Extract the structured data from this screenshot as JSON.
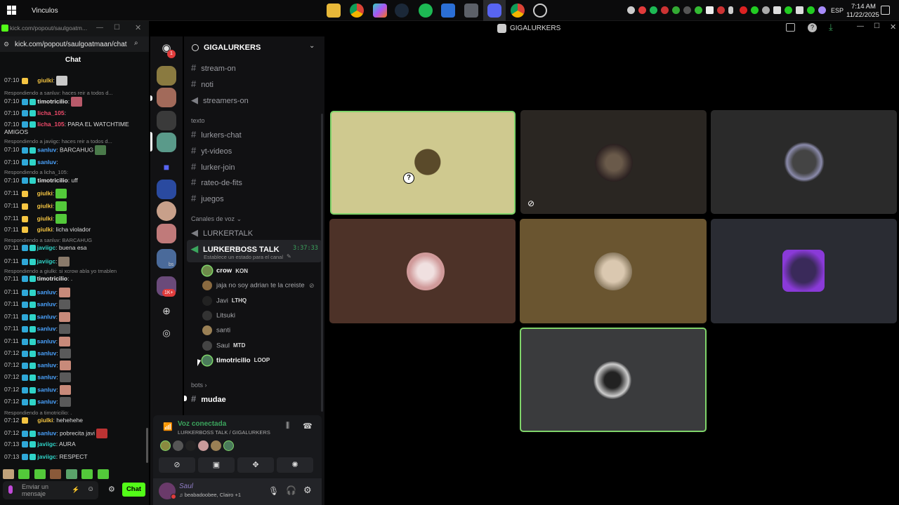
{
  "taskbar": {
    "app_name": "Vinculos",
    "language": "ESP",
    "time": "7:14 AM",
    "date": "11/22/2025"
  },
  "kick": {
    "window_title": "kick.com/popout/saulgoatm...",
    "url": "kick.com/popout/saulgoatmaan/chat",
    "chat_header": "Chat",
    "input_placeholder": "Enviar un mensaje",
    "chat_button": "Chat",
    "messages": [
      {
        "time": "07:10",
        "user": "giulki",
        "color": "#f5c542",
        "text": ":"
      },
      {
        "reply": "Respondiendo a sanluv: haces reir a todos d..."
      },
      {
        "time": "07:10",
        "user": "timotricilio",
        "color": "#e8e8e8",
        "text": ":"
      },
      {
        "time": "07:10",
        "user": "licha_105",
        "color": "#f04a6a",
        "text": ":"
      },
      {
        "time": "07:10",
        "user": "licha_105",
        "color": "#f04a6a",
        "text": ": PARA EL WATCHTIME",
        "cont": "AMIGOS"
      },
      {
        "reply": "Respondiendo a javiigc: haces reir a todos d..."
      },
      {
        "time": "07:10",
        "user": "sanluv",
        "color": "#4aa3ff",
        "text": ": BARCAHUG"
      },
      {
        "time": "07:10",
        "user": "sanluv",
        "color": "#4aa3ff",
        "text": ":"
      },
      {
        "reply": "Respondiendo a licha_105:"
      },
      {
        "time": "07:10",
        "user": "timotricilio",
        "color": "#e8e8e8",
        "text": ": uff"
      },
      {
        "time": "07:11",
        "user": "giulki",
        "color": "#f5c542",
        "text": ":"
      },
      {
        "time": "07:11",
        "user": "giulki",
        "color": "#f5c542",
        "text": ":"
      },
      {
        "time": "07:11",
        "user": "giulki",
        "color": "#f5c542",
        "text": ":"
      },
      {
        "time": "07:11",
        "user": "giulki",
        "color": "#f5c542",
        "text": ": licha violador"
      },
      {
        "reply": "Respondiendo a sanluv: BARCAHUG"
      },
      {
        "time": "07:11",
        "user": "javiigc",
        "color": "#2fd4c8",
        "text": ": buena esa"
      },
      {
        "time": "07:11",
        "user": "javiigc",
        "color": "#2fd4c8",
        "text": ":"
      },
      {
        "reply": "Respondiendo a giulki: si xcrow abla yo tmablen"
      },
      {
        "time": "07:11",
        "user": "timotricilio",
        "color": "#e8e8e8",
        "text": ": ."
      },
      {
        "time": "07:11",
        "user": "sanluv",
        "color": "#4aa3ff",
        "text": ":"
      },
      {
        "time": "07:11",
        "user": "sanluv",
        "color": "#4aa3ff",
        "text": ":"
      },
      {
        "time": "07:11",
        "user": "sanluv",
        "color": "#4aa3ff",
        "text": ":"
      },
      {
        "time": "07:11",
        "user": "sanluv",
        "color": "#4aa3ff",
        "text": ":"
      },
      {
        "time": "07:11",
        "user": "sanluv",
        "color": "#4aa3ff",
        "text": ":"
      },
      {
        "time": "07:12",
        "user": "sanluv",
        "color": "#4aa3ff",
        "text": ":"
      },
      {
        "time": "07:12",
        "user": "sanluv",
        "color": "#4aa3ff",
        "text": ":"
      },
      {
        "time": "07:12",
        "user": "sanluv",
        "color": "#4aa3ff",
        "text": ":"
      },
      {
        "time": "07:12",
        "user": "sanluv",
        "color": "#4aa3ff",
        "text": ":"
      },
      {
        "time": "07:12",
        "user": "sanluv",
        "color": "#4aa3ff",
        "text": ":"
      },
      {
        "reply": "Respondiendo a timotricilio: ."
      },
      {
        "time": "07:12",
        "user": "giulki",
        "color": "#f5c542",
        "text": ": hehehehe"
      },
      {
        "time": "07:12",
        "user": "sanluv",
        "color": "#4aa3ff",
        "text": ": pobrecita javi"
      },
      {
        "time": "07:13",
        "user": "javiigc",
        "color": "#2fd4c8",
        "text": ": AURA"
      },
      {
        "time": "07:13",
        "user": "javiigc",
        "color": "#2fd4c8",
        "text": ": RESPECT"
      }
    ]
  },
  "discord": {
    "window_title": "GIGALURKERS",
    "server_name": "GIGALURKERS",
    "server_badge": "1",
    "server_badge_2": "1K+",
    "server_small_label": "bs",
    "channels_top": [
      "stream-on",
      "noti",
      "streamers-on"
    ],
    "category_texto": "texto",
    "text_channels": [
      "lurkers-chat",
      "yt-videos",
      "lurker-join",
      "rateo-de-fits",
      "juegos"
    ],
    "category_voz": "Canales de voz",
    "voice_channel_1": "LURKERTALK",
    "voice_channel_2": "LURKERBOSS TALK",
    "voice_timer": "3:37:33",
    "voice_status": "Establece un estado para el canal",
    "voice_users": [
      {
        "name": "crow",
        "tag": "KON",
        "color": "#6d8a4a"
      },
      {
        "name": "jaja no soy adrian te la creiste",
        "tag": "",
        "color": "#8a6a40"
      },
      {
        "name": "Javi",
        "tag": "LTHQ",
        "color": "#222"
      },
      {
        "name": "Litsuki",
        "tag": "",
        "color": "#333"
      },
      {
        "name": "santi",
        "tag": "",
        "color": "#9a8055"
      },
      {
        "name": "Saul",
        "tag": "MTD",
        "color": "#444"
      },
      {
        "name": "timotricilio",
        "tag": "LOOP",
        "color": "#4a7a5a"
      }
    ],
    "category_bots": "bots",
    "bot_channel": "mudae",
    "voice_connected": "Voz conectada",
    "voice_path": "LURKERBOSS TALK / GIGALURKERS",
    "user_name": "Saul",
    "user_status": "beabadoobee, Clairo +1"
  },
  "colors": {
    "kick_green": "#53fc18",
    "discord_green": "#3ba55d",
    "speaking_border": "#7fd46a"
  }
}
